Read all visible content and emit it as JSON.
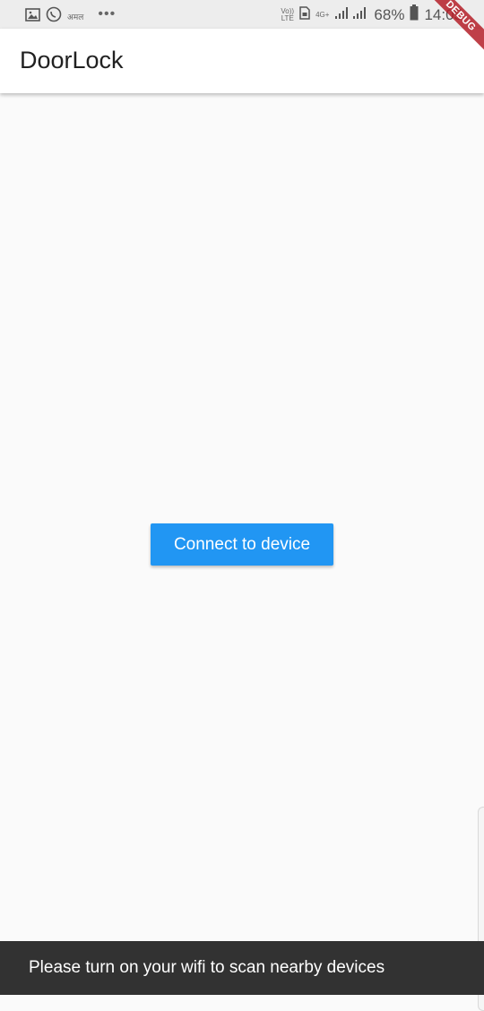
{
  "status_bar": {
    "left_icons": [
      "gallery-icon",
      "whatsapp-icon"
    ],
    "notification_text": "अमल",
    "overflow": "•••",
    "volte_top": "Vo))",
    "volte_bottom": "LTE",
    "network_type": "4G+",
    "battery_percent": "68%",
    "time": "14:05"
  },
  "app_bar": {
    "title": "DoorLock"
  },
  "debug_banner": {
    "label": "DEBUG"
  },
  "main": {
    "connect_button_label": "Connect to device"
  },
  "snackbar": {
    "message": "Please turn on your wifi to scan nearby devices"
  },
  "colors": {
    "primary": "#2196f3",
    "snackbar_bg": "#323232",
    "background": "#fafafa"
  }
}
